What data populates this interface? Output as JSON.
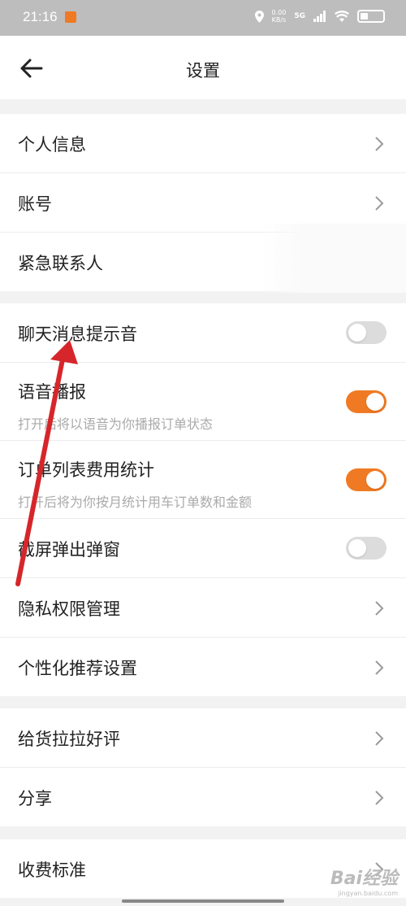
{
  "status_bar": {
    "time": "21:16",
    "net_speed_value": "0.00",
    "net_speed_unit": "KB/s",
    "network": "5G"
  },
  "header": {
    "title": "设置"
  },
  "groups": [
    {
      "items": [
        {
          "label": "个人信息"
        },
        {
          "label": "账号"
        },
        {
          "label": "紧急联系人"
        }
      ]
    },
    {
      "items": [
        {
          "label": "聊天消息提示音",
          "toggle": false
        },
        {
          "label": "语音播报",
          "sublabel": "打开后将以语音为你播报订单状态",
          "toggle": true
        },
        {
          "label": "订单列表费用统计",
          "sublabel": "打开后将为你按月统计用车订单数和金额",
          "toggle": true
        },
        {
          "label": "截屏弹出弹窗",
          "toggle": false
        },
        {
          "label": "隐私权限管理"
        },
        {
          "label": "个性化推荐设置"
        }
      ]
    },
    {
      "items": [
        {
          "label": "给货拉拉好评"
        },
        {
          "label": "分享"
        }
      ]
    },
    {
      "items": [
        {
          "label": "收费标准"
        }
      ]
    }
  ],
  "watermark": {
    "brand": "Bai经验",
    "url": "jingyan.baidu.com"
  },
  "colors": {
    "accent": "#f07a23",
    "toggle_off": "#dcdcdc",
    "background": "#f2f2f2"
  }
}
